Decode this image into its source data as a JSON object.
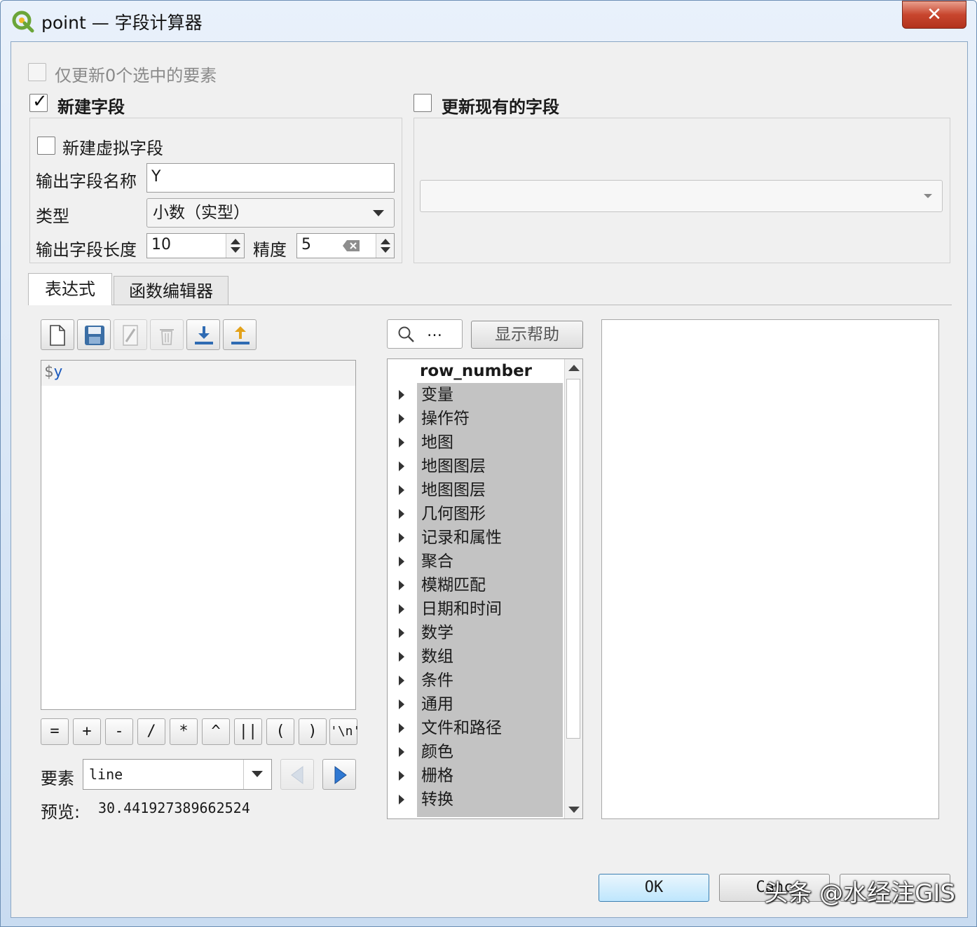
{
  "window": {
    "title": "point — 字段计算器",
    "close_glyph": "✕"
  },
  "top": {
    "update_selected_label": "仅更新0个选中的要素",
    "new_field_label": "新建字段",
    "update_existing_label": "更新现有的字段",
    "new_field_checked": true,
    "update_existing_checked": false,
    "update_selected_checked": false
  },
  "new_field": {
    "virtual_label": "新建虚拟字段",
    "name_label": "输出字段名称",
    "name_value": "Y",
    "type_label": "类型",
    "type_value": "小数（实型）",
    "length_label": "输出字段长度",
    "length_value": "10",
    "precision_label": "精度",
    "precision_value": "5"
  },
  "existing": {
    "field_value": ""
  },
  "tabs": [
    {
      "label": "表达式",
      "active": true
    },
    {
      "label": "函数编辑器",
      "active": false
    }
  ],
  "toolbar": {
    "icons": [
      "new-file-icon",
      "save-icon",
      "edit-icon",
      "delete-icon",
      "import-icon",
      "export-icon"
    ]
  },
  "editor": {
    "dollar": "$",
    "var": "y"
  },
  "operators": [
    "=",
    "+",
    "-",
    "/",
    "*",
    "^",
    "||",
    "(",
    ")",
    "'\\n'"
  ],
  "feature": {
    "label": "要素",
    "value": "line"
  },
  "preview": {
    "label": "预览:",
    "value": "30.441927389662524"
  },
  "search": {
    "dots": "…",
    "help_button": "显示帮助"
  },
  "tree": {
    "header": "row_number",
    "items": [
      "变量",
      "操作符",
      "地图",
      "地图图层",
      "地图图层",
      "几何图形",
      "记录和属性",
      "聚合",
      "模糊匹配",
      "日期和时间",
      "数学",
      "数组",
      "条件",
      "通用",
      "文件和路径",
      "颜色",
      "栅格",
      "转换"
    ]
  },
  "footer": {
    "ok": "OK",
    "cancel": "Canc"
  },
  "watermark": "头条 @水经注GIS",
  "colors": {
    "accent": "#1c5bbf",
    "selection": "#c3c3c3",
    "close": "#c8462e"
  }
}
